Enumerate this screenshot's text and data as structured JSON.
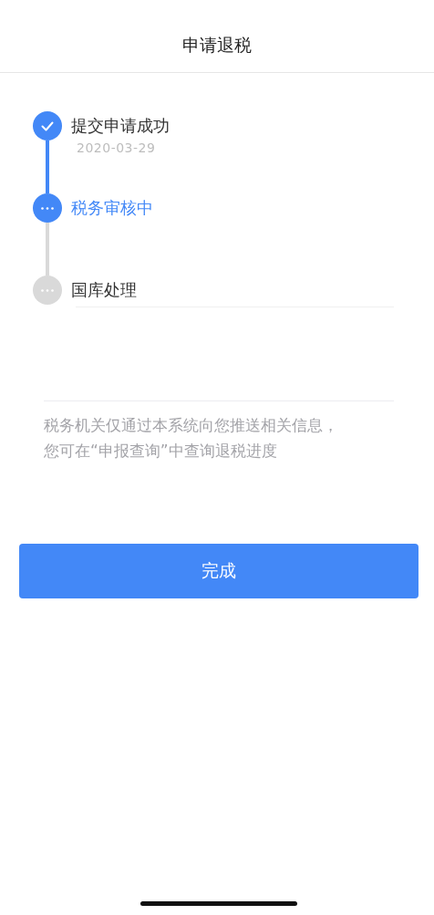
{
  "header": {
    "title": "申请退税"
  },
  "steps": [
    {
      "kind": "done",
      "title": "提交申请成功",
      "date": "2020-03-29"
    },
    {
      "kind": "active",
      "title": "税务审核中"
    },
    {
      "kind": "pending",
      "title": "国库处理"
    }
  ],
  "notice": "税务机关仅通过本系统向您推送相关信息，您可在“申报查询”中查询退税进度",
  "button": {
    "label": "完成"
  }
}
